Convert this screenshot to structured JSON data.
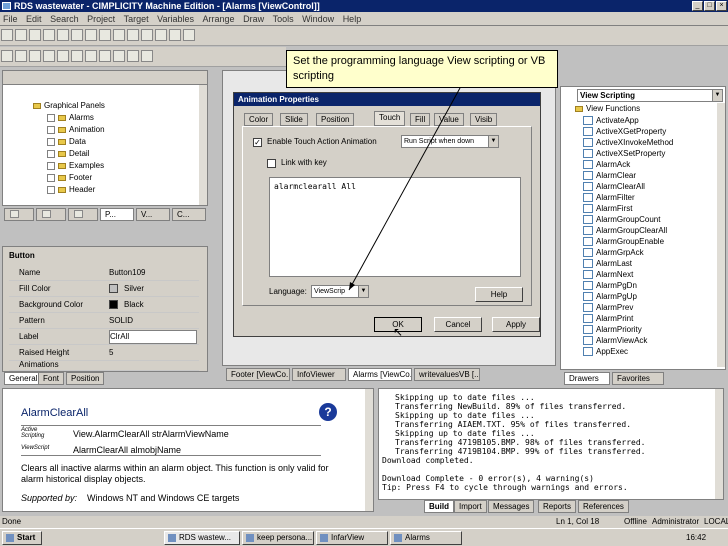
{
  "window": {
    "title": "RDS wastewater - CIMPLICITY Machine Edition - [Alarms [ViewControl]]"
  },
  "menu": [
    "File",
    "Edit",
    "Search",
    "Project",
    "Target",
    "Variables",
    "Arrange",
    "Draw",
    "Tools",
    "Window",
    "Help"
  ],
  "tree": {
    "root": "Graphical Panels",
    "items": [
      "Alarms",
      "Animation",
      "Data",
      "Detail",
      "Examples",
      "Footer",
      "Header"
    ]
  },
  "left_tabs": {
    "tab3": "P...",
    "tab4": "V...",
    "tab5": "C..."
  },
  "properties": {
    "object": "Button",
    "rows": [
      {
        "key": "Name",
        "value": "Button109"
      },
      {
        "key": "Fill Color",
        "value": "Silver"
      },
      {
        "key": "Background Color",
        "value": "Black"
      },
      {
        "key": "Pattern",
        "value": "SOLID"
      },
      {
        "key": "Label",
        "value": "ClrAll"
      },
      {
        "key": "Raised Height",
        "value": "5"
      },
      {
        "key": "Animations",
        "value": ""
      }
    ],
    "tabs": [
      "General",
      "Font",
      "Position"
    ]
  },
  "dialog": {
    "title": "Animation Properties",
    "tabs": [
      "Color",
      "Slide",
      "Position",
      "Touch",
      "Fill",
      "Value",
      "Visib"
    ],
    "enable_touch": "Enable Touch Action Animation",
    "action_combo": "Run Script when down",
    "link_with_key": "Link with key",
    "script": "alarmclearall All",
    "language_label": "Language:",
    "language_value": "ViewScrip",
    "help": "Help",
    "ok": "OK",
    "cancel": "Cancel",
    "apply": "Apply"
  },
  "callout": "Set the programming language View scripting or VB scripting",
  "doc_tabs": [
    "Footer [ViewCo...",
    "InfoViewer",
    "Alarms [ViewCo...",
    "writevaluesVB [..."
  ],
  "right_panel": {
    "combo": "View Scripting",
    "root": "View Functions",
    "functions": [
      "ActivateApp",
      "ActiveXGetProperty",
      "ActiveXInvokeMethod",
      "ActiveXSetProperty",
      "AlarmAck",
      "AlarmClear",
      "AlarmClearAll",
      "AlarmFilter",
      "AlarmFirst",
      "AlarmGroupCount",
      "AlarmGroupClearAll",
      "AlarmGroupEnable",
      "AlarmGrpAck",
      "AlarmLast",
      "AlarmNext",
      "AlarmPgDn",
      "AlarmPgUp",
      "AlarmPrev",
      "AlarmPrint",
      "AlarmPriority",
      "AlarmViewAck",
      "AppExec"
    ],
    "tabs": [
      "Drawers",
      "Favorites"
    ]
  },
  "help_panel": {
    "title": "AlarmClearAll",
    "active_label": "Active Scripting",
    "active_syntax": "View.AlarmClearAll strAlarmViewName",
    "view_label": "ViewScript",
    "view_syntax": "AlarmClearAll almobjName",
    "desc": "Clears all inactive alarms within an alarm object. This function is only valid for alarm historical display objects.",
    "supported_label": "Supported by:",
    "supported": "Windows NT and Windows CE targets"
  },
  "output": {
    "lines": [
      "Skipping up to date files ...",
      "Transferring NewBuild. 89% of files transferred.",
      "Skipping up to date files ...",
      "Transferring AIAEM.TXT. 95% of files transferred.",
      "Skipping up to date files ...",
      "Transferring 4719B105.BMP. 98% of files transferred.",
      "Transferring 4719B104.BMP. 99% of files transferred.",
      "Download completed.",
      "",
      "Download Complete - 0 error(s), 4 warning(s)",
      "Tip: Press F4 to cycle through warnings and errors."
    ],
    "tabs": [
      "Build",
      "Import",
      "Messages",
      "Reports",
      "References"
    ]
  },
  "status": {
    "left": "Done",
    "pos": "Ln 1, Col 18",
    "mode": "Offline",
    "user": "Administrator",
    "loc": "LOCAL"
  },
  "taskbar": {
    "start": "Start",
    "tasks": [
      "RDS wastew...",
      "keep persona...",
      "InfarView",
      "Alarms"
    ],
    "clock": "16:42"
  }
}
